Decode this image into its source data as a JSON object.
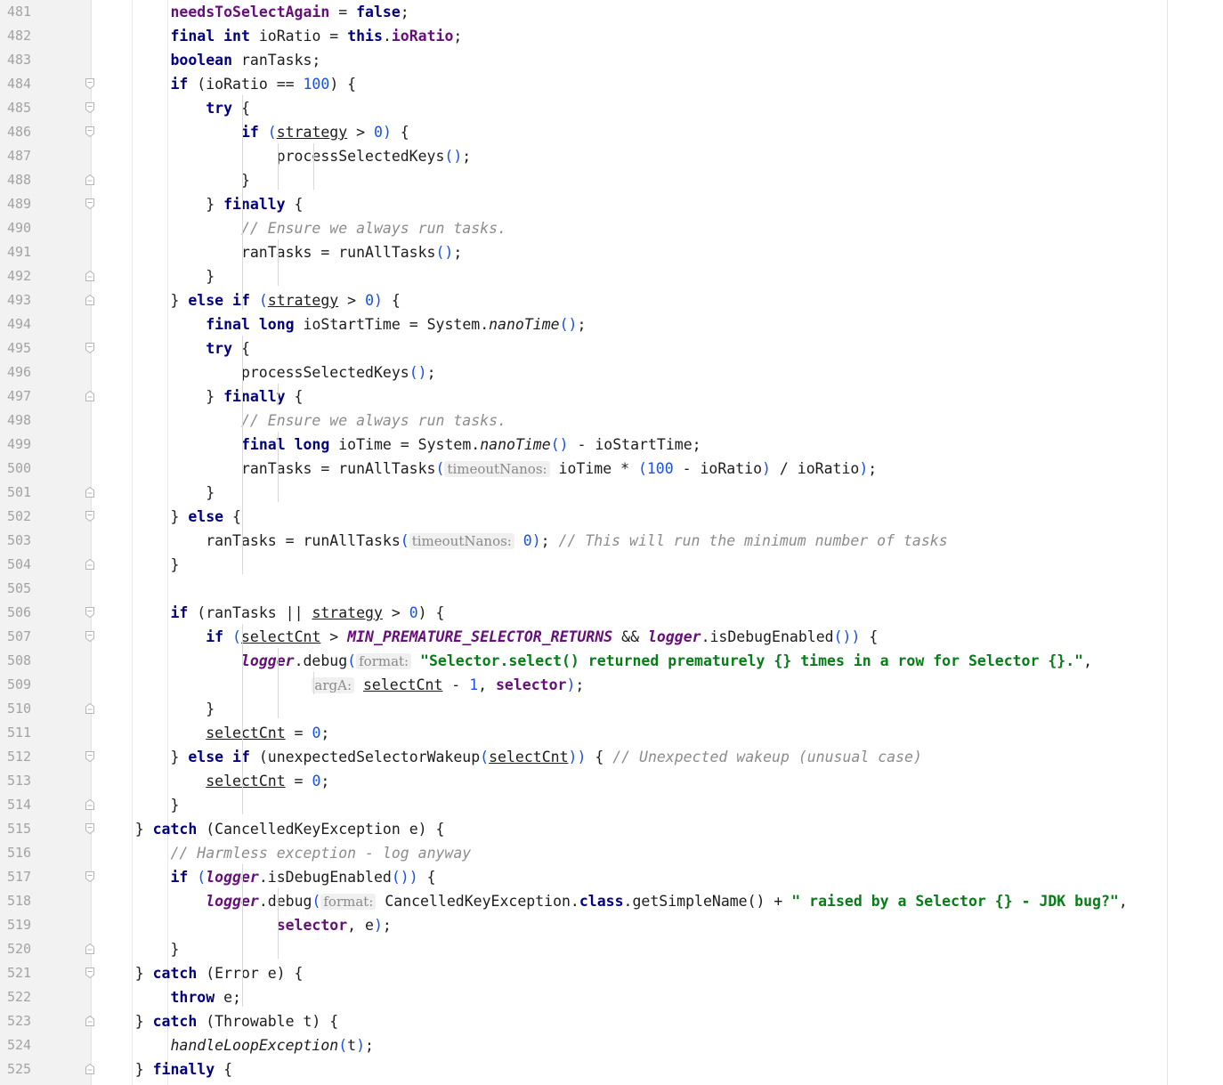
{
  "editor": {
    "language": "java",
    "lines": [
      {
        "num": "481",
        "fold": "",
        "tokens": [
          [
            "",
            "        "
          ],
          [
            "fld",
            "needsToSelectAgain"
          ],
          [
            "",
            " = "
          ],
          [
            "kw",
            "false"
          ],
          [
            "",
            ";"
          ]
        ]
      },
      {
        "num": "482",
        "fold": "",
        "tokens": [
          [
            "",
            "        "
          ],
          [
            "kw",
            "final"
          ],
          [
            "",
            " "
          ],
          [
            "kw",
            "int"
          ],
          [
            "",
            " ioRatio = "
          ],
          [
            "kw",
            "this"
          ],
          [
            "",
            "."
          ],
          [
            "fld",
            "ioRatio"
          ],
          [
            "",
            ";"
          ]
        ]
      },
      {
        "num": "483",
        "fold": "",
        "tokens": [
          [
            "",
            "        "
          ],
          [
            "kw",
            "boolean"
          ],
          [
            "",
            " ranTasks;"
          ]
        ]
      },
      {
        "num": "484",
        "fold": "open",
        "tokens": [
          [
            "",
            "        "
          ],
          [
            "kw",
            "if"
          ],
          [
            "",
            " (ioRatio == "
          ],
          [
            "num",
            "100"
          ],
          [
            "",
            ") {"
          ]
        ]
      },
      {
        "num": "485",
        "fold": "open",
        "tokens": [
          [
            "",
            "            "
          ],
          [
            "kw",
            "try"
          ],
          [
            "",
            " {"
          ]
        ]
      },
      {
        "num": "486",
        "fold": "open",
        "tokens": [
          [
            "",
            "                "
          ],
          [
            "kw",
            "if"
          ],
          [
            "",
            " "
          ],
          [
            "paren",
            "("
          ],
          [
            "lv",
            "strategy"
          ],
          [
            "",
            " > "
          ],
          [
            "num",
            "0"
          ],
          [
            "paren",
            ")"
          ],
          [
            "",
            " {"
          ]
        ]
      },
      {
        "num": "487",
        "fold": "",
        "tokens": [
          [
            "",
            "                    processSelectedKeys"
          ],
          [
            "paren",
            "()"
          ],
          [
            "",
            ";"
          ]
        ]
      },
      {
        "num": "488",
        "fold": "close",
        "tokens": [
          [
            "",
            "                }"
          ]
        ]
      },
      {
        "num": "489",
        "fold": "open",
        "tokens": [
          [
            "",
            "            } "
          ],
          [
            "kw",
            "finally"
          ],
          [
            "",
            " {"
          ]
        ]
      },
      {
        "num": "490",
        "fold": "",
        "tokens": [
          [
            "",
            "                "
          ],
          [
            "cmt",
            "// Ensure we always run tasks."
          ]
        ]
      },
      {
        "num": "491",
        "fold": "",
        "tokens": [
          [
            "",
            "                ranTasks = runAllTasks"
          ],
          [
            "paren",
            "()"
          ],
          [
            "",
            ";"
          ]
        ]
      },
      {
        "num": "492",
        "fold": "close",
        "tokens": [
          [
            "",
            "            }"
          ]
        ]
      },
      {
        "num": "493",
        "fold": "close",
        "tokens": [
          [
            "",
            "        } "
          ],
          [
            "kw",
            "else if"
          ],
          [
            "",
            " "
          ],
          [
            "paren",
            "("
          ],
          [
            "lv",
            "strategy"
          ],
          [
            "",
            " > "
          ],
          [
            "num",
            "0"
          ],
          [
            "paren",
            ")"
          ],
          [
            "",
            " {"
          ]
        ]
      },
      {
        "num": "494",
        "fold": "",
        "tokens": [
          [
            "",
            "            "
          ],
          [
            "kw",
            "final"
          ],
          [
            "",
            " "
          ],
          [
            "kw",
            "long"
          ],
          [
            "",
            " ioStartTime = System."
          ],
          [
            "mth-it",
            "nanoTime"
          ],
          [
            "paren",
            "()"
          ],
          [
            "",
            ";"
          ]
        ]
      },
      {
        "num": "495",
        "fold": "open",
        "tokens": [
          [
            "",
            "            "
          ],
          [
            "kw",
            "try"
          ],
          [
            "",
            " {"
          ]
        ]
      },
      {
        "num": "496",
        "fold": "",
        "tokens": [
          [
            "",
            "                processSelectedKeys"
          ],
          [
            "paren",
            "()"
          ],
          [
            "",
            ";"
          ]
        ]
      },
      {
        "num": "497",
        "fold": "close",
        "tokens": [
          [
            "",
            "            } "
          ],
          [
            "kw",
            "finally"
          ],
          [
            "",
            " {"
          ]
        ]
      },
      {
        "num": "498",
        "fold": "",
        "tokens": [
          [
            "",
            "                "
          ],
          [
            "cmt",
            "// Ensure we always run tasks."
          ]
        ]
      },
      {
        "num": "499",
        "fold": "",
        "tokens": [
          [
            "",
            "                "
          ],
          [
            "kw",
            "final"
          ],
          [
            "",
            " "
          ],
          [
            "kw",
            "long"
          ],
          [
            "",
            " ioTime = System."
          ],
          [
            "mth-it",
            "nanoTime"
          ],
          [
            "paren",
            "()"
          ],
          [
            "",
            " - ioStartTime;"
          ]
        ]
      },
      {
        "num": "500",
        "fold": "",
        "tokens": [
          [
            "",
            "                ranTasks = runAllTasks"
          ],
          [
            "paren",
            "("
          ],
          [
            "hint",
            "timeoutNanos:"
          ],
          [
            "",
            " ioTime * "
          ],
          [
            "paren",
            "("
          ],
          [
            "num",
            "100"
          ],
          [
            "",
            " - ioRatio"
          ],
          [
            "paren",
            ")"
          ],
          [
            "",
            " / ioRatio"
          ],
          [
            "paren",
            ")"
          ],
          [
            "",
            ";"
          ]
        ]
      },
      {
        "num": "501",
        "fold": "close",
        "tokens": [
          [
            "",
            "            }"
          ]
        ]
      },
      {
        "num": "502",
        "fold": "open",
        "tokens": [
          [
            "",
            "        } "
          ],
          [
            "kw",
            "else"
          ],
          [
            "",
            " {"
          ]
        ]
      },
      {
        "num": "503",
        "fold": "",
        "tokens": [
          [
            "",
            "            ranTasks = runAllTasks"
          ],
          [
            "paren",
            "("
          ],
          [
            "hint",
            "timeoutNanos:"
          ],
          [
            "num",
            " 0"
          ],
          [
            "paren",
            ")"
          ],
          [
            "",
            "; "
          ],
          [
            "cmt",
            "// This will run the minimum number of tasks"
          ]
        ]
      },
      {
        "num": "504",
        "fold": "close",
        "tokens": [
          [
            "",
            "        }"
          ]
        ]
      },
      {
        "num": "505",
        "fold": "",
        "tokens": []
      },
      {
        "num": "506",
        "fold": "open",
        "tokens": [
          [
            "",
            "        "
          ],
          [
            "kw",
            "if"
          ],
          [
            "",
            " (ranTasks || "
          ],
          [
            "lv",
            "strategy"
          ],
          [
            "",
            " > "
          ],
          [
            "num",
            "0"
          ],
          [
            "",
            ") {"
          ]
        ]
      },
      {
        "num": "507",
        "fold": "open",
        "tokens": [
          [
            "",
            "            "
          ],
          [
            "kw",
            "if"
          ],
          [
            "",
            " "
          ],
          [
            "paren",
            "("
          ],
          [
            "lv",
            "selectCnt"
          ],
          [
            "",
            " > "
          ],
          [
            "sfld",
            "MIN_PREMATURE_SELECTOR_RETURNS"
          ],
          [
            "",
            " && "
          ],
          [
            "sfld",
            "logger"
          ],
          [
            "",
            ".isDebugEnabled"
          ],
          [
            "paren",
            "()"
          ],
          [
            "paren",
            ")"
          ],
          [
            "",
            " {"
          ]
        ]
      },
      {
        "num": "508",
        "fold": "",
        "tokens": [
          [
            "",
            "                "
          ],
          [
            "sfld",
            "logger"
          ],
          [
            "",
            ".debug"
          ],
          [
            "paren",
            "("
          ],
          [
            "hint",
            "format:"
          ],
          [
            "str",
            " \"Selector.select() returned prematurely {} times in a row for Selector {}.\""
          ],
          [
            "",
            ","
          ]
        ]
      },
      {
        "num": "509",
        "fold": "",
        "tokens": [
          [
            "",
            "                        "
          ],
          [
            "hint",
            "argA:"
          ],
          [
            "",
            " "
          ],
          [
            "lv",
            "selectCnt"
          ],
          [
            "",
            " - "
          ],
          [
            "num",
            "1"
          ],
          [
            "",
            ", "
          ],
          [
            "fld",
            "selector"
          ],
          [
            "paren",
            ")"
          ],
          [
            "",
            ";"
          ]
        ]
      },
      {
        "num": "510",
        "fold": "close",
        "tokens": [
          [
            "",
            "            }"
          ]
        ]
      },
      {
        "num": "511",
        "fold": "",
        "tokens": [
          [
            "",
            "            "
          ],
          [
            "lv",
            "selectCnt"
          ],
          [
            "",
            " = "
          ],
          [
            "num",
            "0"
          ],
          [
            "",
            ";"
          ]
        ]
      },
      {
        "num": "512",
        "fold": "open",
        "tokens": [
          [
            "",
            "        } "
          ],
          [
            "kw",
            "else if"
          ],
          [
            "",
            " (unexpectedSelectorWakeup"
          ],
          [
            "paren",
            "("
          ],
          [
            "lv",
            "selectCnt"
          ],
          [
            "paren",
            "))"
          ],
          [
            "",
            " { "
          ],
          [
            "cmt",
            "// Unexpected wakeup (unusual case)"
          ]
        ]
      },
      {
        "num": "513",
        "fold": "",
        "tokens": [
          [
            "",
            "            "
          ],
          [
            "lv",
            "selectCnt"
          ],
          [
            "",
            " = "
          ],
          [
            "num",
            "0"
          ],
          [
            "",
            ";"
          ]
        ]
      },
      {
        "num": "514",
        "fold": "close",
        "tokens": [
          [
            "",
            "        }"
          ]
        ]
      },
      {
        "num": "515",
        "fold": "open",
        "tokens": [
          [
            "",
            "    } "
          ],
          [
            "kw",
            "catch"
          ],
          [
            "",
            " (CancelledKeyException e) {"
          ]
        ]
      },
      {
        "num": "516",
        "fold": "",
        "tokens": [
          [
            "",
            "        "
          ],
          [
            "cmt",
            "// Harmless exception - log anyway"
          ]
        ]
      },
      {
        "num": "517",
        "fold": "open",
        "tokens": [
          [
            "",
            "        "
          ],
          [
            "kw",
            "if"
          ],
          [
            "",
            " "
          ],
          [
            "paren",
            "("
          ],
          [
            "sfld",
            "logger"
          ],
          [
            "",
            ".isDebugEnabled"
          ],
          [
            "paren",
            "()"
          ],
          [
            "paren",
            ")"
          ],
          [
            "",
            " {"
          ]
        ]
      },
      {
        "num": "518",
        "fold": "",
        "tokens": [
          [
            "",
            "            "
          ],
          [
            "sfld",
            "logger"
          ],
          [
            "",
            ".debug"
          ],
          [
            "paren",
            "("
          ],
          [
            "hint",
            "format:"
          ],
          [
            "",
            " CancelledKeyException."
          ],
          [
            "kw",
            "class"
          ],
          [
            "",
            ".getSimpleName() + "
          ],
          [
            "str",
            "\" raised by a Selector {} - JDK bug?\""
          ],
          [
            "",
            ","
          ]
        ]
      },
      {
        "num": "519",
        "fold": "",
        "tokens": [
          [
            "",
            "                    "
          ],
          [
            "fld",
            "selector"
          ],
          [
            "",
            ", e"
          ],
          [
            "paren",
            ")"
          ],
          [
            "",
            ";"
          ]
        ]
      },
      {
        "num": "520",
        "fold": "close",
        "tokens": [
          [
            "",
            "        }"
          ]
        ]
      },
      {
        "num": "521",
        "fold": "open",
        "tokens": [
          [
            "",
            "    } "
          ],
          [
            "kw",
            "catch"
          ],
          [
            "",
            " (Error e) {"
          ]
        ]
      },
      {
        "num": "522",
        "fold": "",
        "tokens": [
          [
            "",
            "        "
          ],
          [
            "kw",
            "throw"
          ],
          [
            "",
            " e;"
          ]
        ]
      },
      {
        "num": "523",
        "fold": "close",
        "tokens": [
          [
            "",
            "    } "
          ],
          [
            "kw",
            "catch"
          ],
          [
            "",
            " (Throwable t) {"
          ]
        ]
      },
      {
        "num": "524",
        "fold": "",
        "tokens": [
          [
            "",
            "        "
          ],
          [
            "mth-it",
            "handleLoopException"
          ],
          [
            "paren",
            "("
          ],
          [
            "",
            "t"
          ],
          [
            "paren",
            ")"
          ],
          [
            "",
            ";"
          ]
        ]
      },
      {
        "num": "525",
        "fold": "close",
        "tokens": [
          [
            "",
            "    } "
          ],
          [
            "kw",
            "finally"
          ],
          [
            "",
            " {"
          ]
        ]
      }
    ]
  }
}
